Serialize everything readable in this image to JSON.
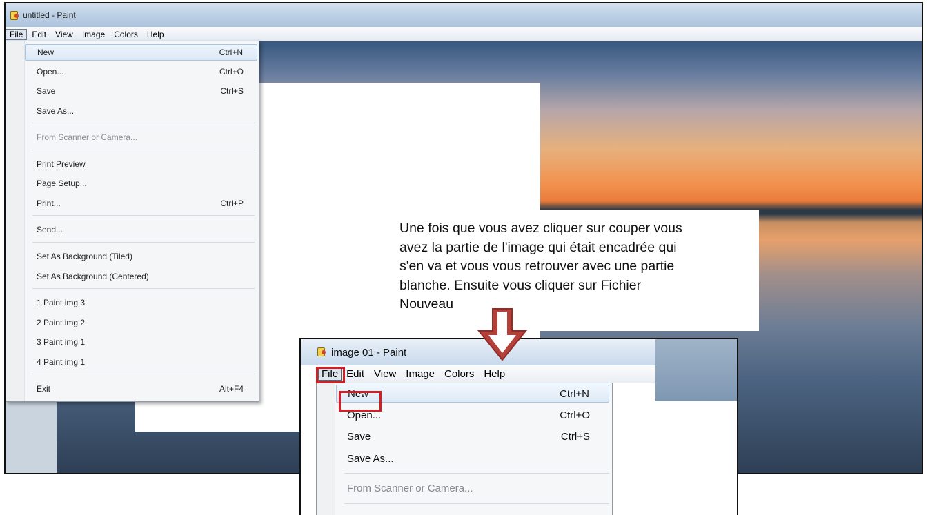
{
  "main_window": {
    "title": "untitled - Paint",
    "menu": [
      "File",
      "Edit",
      "View",
      "Image",
      "Colors",
      "Help"
    ],
    "file_menu": {
      "items": [
        {
          "label": "New",
          "shortcut": "Ctrl+N"
        },
        {
          "label": "Open...",
          "shortcut": "Ctrl+O"
        },
        {
          "label": "Save",
          "shortcut": "Ctrl+S"
        },
        {
          "label": "Save As...",
          "shortcut": ""
        },
        {
          "label": "From Scanner or Camera...",
          "shortcut": ""
        },
        {
          "label": "Print Preview",
          "shortcut": ""
        },
        {
          "label": "Page Setup...",
          "shortcut": ""
        },
        {
          "label": "Print...",
          "shortcut": "Ctrl+P"
        },
        {
          "label": "Send...",
          "shortcut": ""
        },
        {
          "label": "Set As Background (Tiled)",
          "shortcut": ""
        },
        {
          "label": "Set As Background (Centered)",
          "shortcut": ""
        },
        {
          "label": "1 Paint img 3",
          "shortcut": ""
        },
        {
          "label": "2 Paint img 2",
          "shortcut": ""
        },
        {
          "label": "3 Paint img 1",
          "shortcut": ""
        },
        {
          "label": "4 Paint img 1",
          "shortcut": ""
        },
        {
          "label": "Exit",
          "shortcut": "Alt+F4"
        }
      ]
    }
  },
  "caption": {
    "lines": [
      "Une fois que vous avez cliquer sur couper vous",
      "avez la partie de l'image qui était encadrée qui",
      "s'en va et vous vous retrouver avec une partie",
      "blanche. Ensuite vous cliquer sur Fichier",
      "Nouveau"
    ]
  },
  "inset_window": {
    "title": "image 01 - Paint",
    "menu": [
      "File",
      "Edit",
      "View",
      "Image",
      "Colors",
      "Help"
    ],
    "file_menu": {
      "items": [
        {
          "label": "New",
          "shortcut": "Ctrl+N"
        },
        {
          "label": "Open...",
          "shortcut": "Ctrl+O"
        },
        {
          "label": "Save",
          "shortcut": "Ctrl+S"
        },
        {
          "label": "Save As...",
          "shortcut": ""
        },
        {
          "label": "From Scanner or Camera...",
          "shortcut": ""
        }
      ]
    }
  },
  "colors": {
    "highlight_red": "#d21f26",
    "arrow_red": "#b5403a"
  },
  "icons": {
    "app_icon": "paint-app-icon",
    "arrow": "down-arrow-icon"
  }
}
